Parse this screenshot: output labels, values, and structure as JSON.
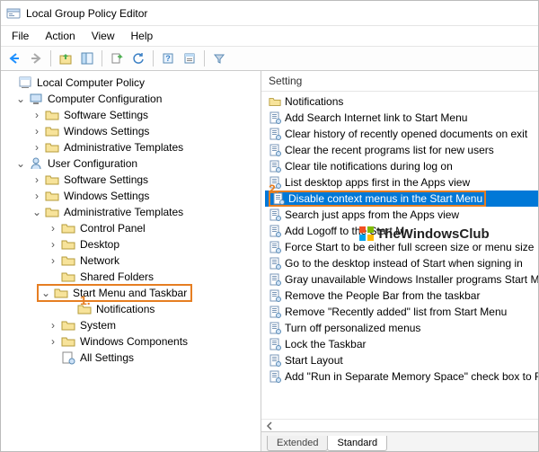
{
  "title": "Local Group Policy Editor",
  "menus": [
    "File",
    "Action",
    "View",
    "Help"
  ],
  "tree": {
    "root": "Local Computer Policy",
    "cc": "Computer Configuration",
    "cc_children": [
      "Software Settings",
      "Windows Settings",
      "Administrative Templates"
    ],
    "uc": "User Configuration",
    "uc_children_top": [
      "Software Settings",
      "Windows Settings"
    ],
    "at": "Administrative Templates",
    "at_children_pre": [
      "Control Panel",
      "Desktop",
      "Network",
      "Shared Folders"
    ],
    "smt": "Start Menu and Taskbar",
    "smt_child": "Notifications",
    "at_children_post": [
      "System",
      "Windows Components",
      "All Settings"
    ]
  },
  "list": {
    "header": "Setting",
    "folder": "Notifications",
    "items": [
      "Add Search Internet link to Start Menu",
      "Clear history of recently opened documents on exit",
      "Clear the recent programs list for new users",
      "Clear tile notifications during log on",
      "List desktop apps first in the Apps view",
      "Disable context menus in the Start Menu",
      "Search just apps from the Apps view",
      "Add Logoff to the Start M",
      "Force Start to be either full screen size or menu size",
      "Go to the desktop instead of Start when signing in",
      "Gray unavailable Windows Installer programs Start Menu",
      "Remove the People Bar from the taskbar",
      "Remove \"Recently added\" list from Start Menu",
      "Turn off personalized menus",
      "Lock the Taskbar",
      "Start Layout",
      "Add \"Run in Separate Memory Space\" check box to Run"
    ],
    "selected_index": 5
  },
  "tabs": [
    "Extended",
    "Standard"
  ],
  "callouts": {
    "one": "1.",
    "two": "2."
  },
  "watermark": "TheWindowsClub"
}
